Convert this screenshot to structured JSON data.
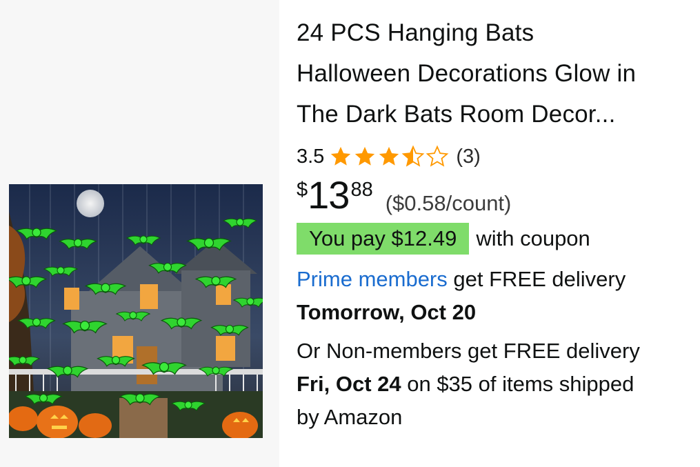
{
  "product": {
    "image_alt": "Glowing green bat decorations hanging in front of a house with pumpkins",
    "title_lines": [
      "24 PCS Hanging Bats",
      "Halloween Decorations Glow in",
      "The Dark Bats Room Decor..."
    ],
    "rating": "3.5",
    "rating_value": 3.5,
    "rating_max": 5,
    "review_count": "(3)",
    "star_color": "#ff9900",
    "price": {
      "symbol": "$",
      "whole": "13",
      "fraction": "88",
      "unit_price": "($0.58/count)"
    },
    "coupon": {
      "badge": "You pay $12.49",
      "suffix": "with coupon",
      "badge_color": "#7fdc6a"
    },
    "delivery": {
      "prime_link": "Prime members",
      "prime_suffix": " get FREE delivery",
      "prime_date": "Tomorrow, Oct 20",
      "nonmember_line": "Or Non-members get FREE delivery",
      "nonmember_date": "Fri, Oct 24",
      "nonmember_suffix": " on $35 of items shipped",
      "nonmember_last": "by Amazon",
      "link_color": "#1a6ccf"
    }
  }
}
